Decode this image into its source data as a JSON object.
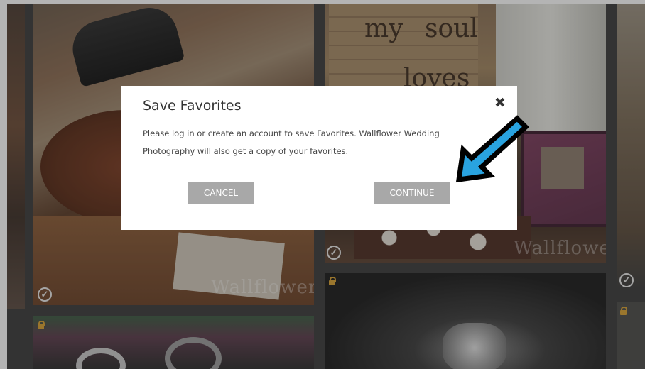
{
  "gallery": {
    "sign_words": [
      "my",
      "soul",
      "loves"
    ],
    "watermark_text": "Wallflower",
    "watermark_text_short": "wer"
  },
  "modal": {
    "title": "Save Favorites",
    "close_glyph": "✖",
    "message": "Please log in or create an account to save Favorites. Wallflower Wedding Photography will also get a copy of your favorites.",
    "cancel_label": "CANCEL",
    "continue_label": "CONTINUE"
  },
  "icons": {
    "check": "✓"
  },
  "colors": {
    "button_bg": "#a8a8a8",
    "arrow_fill": "#29a3e0",
    "arrow_stroke": "#000000",
    "lock": "#d8a030"
  }
}
